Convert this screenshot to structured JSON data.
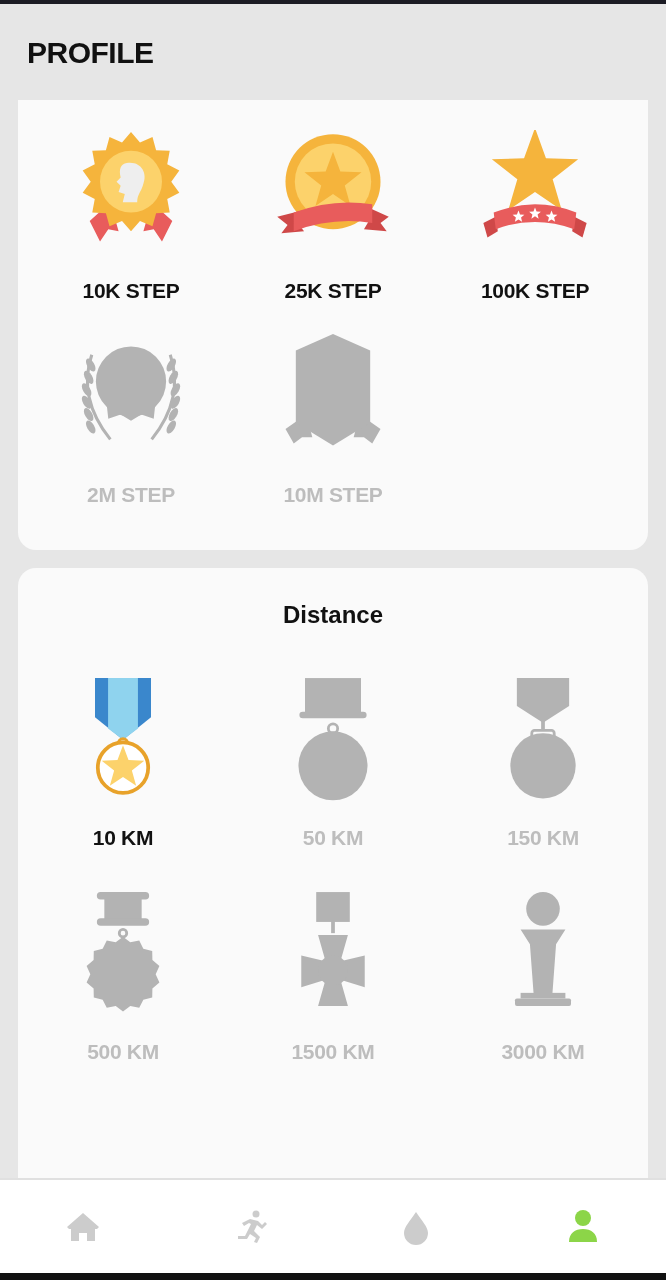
{
  "header": {
    "title": "PROFILE"
  },
  "step_badges": [
    {
      "kind": "rosette",
      "label": "10K STEP",
      "earned": true
    },
    {
      "kind": "coin",
      "label": "25K STEP",
      "earned": true
    },
    {
      "kind": "star",
      "label": "100K STEP",
      "earned": true
    },
    {
      "kind": "laurel",
      "label": "2M STEP",
      "earned": false
    },
    {
      "kind": "shield",
      "label": "10M STEP",
      "earned": false
    }
  ],
  "distance": {
    "title": "Distance",
    "badges": [
      {
        "kind": "ribbon-medal",
        "label": "10 KM",
        "earned": true
      },
      {
        "kind": "bar-medal",
        "label": "50 KM",
        "earned": false
      },
      {
        "kind": "v-medal",
        "label": "150 KM",
        "earned": false
      },
      {
        "kind": "flower-medal",
        "label": "500 KM",
        "earned": false
      },
      {
        "kind": "cross-medal",
        "label": "1500 KM",
        "earned": false
      },
      {
        "kind": "trophy",
        "label": "3000 KM",
        "earned": false
      }
    ]
  },
  "nav": [
    {
      "kind": "home",
      "selected": false
    },
    {
      "kind": "run",
      "selected": false
    },
    {
      "kind": "drop",
      "selected": false
    },
    {
      "kind": "person",
      "selected": true
    }
  ]
}
